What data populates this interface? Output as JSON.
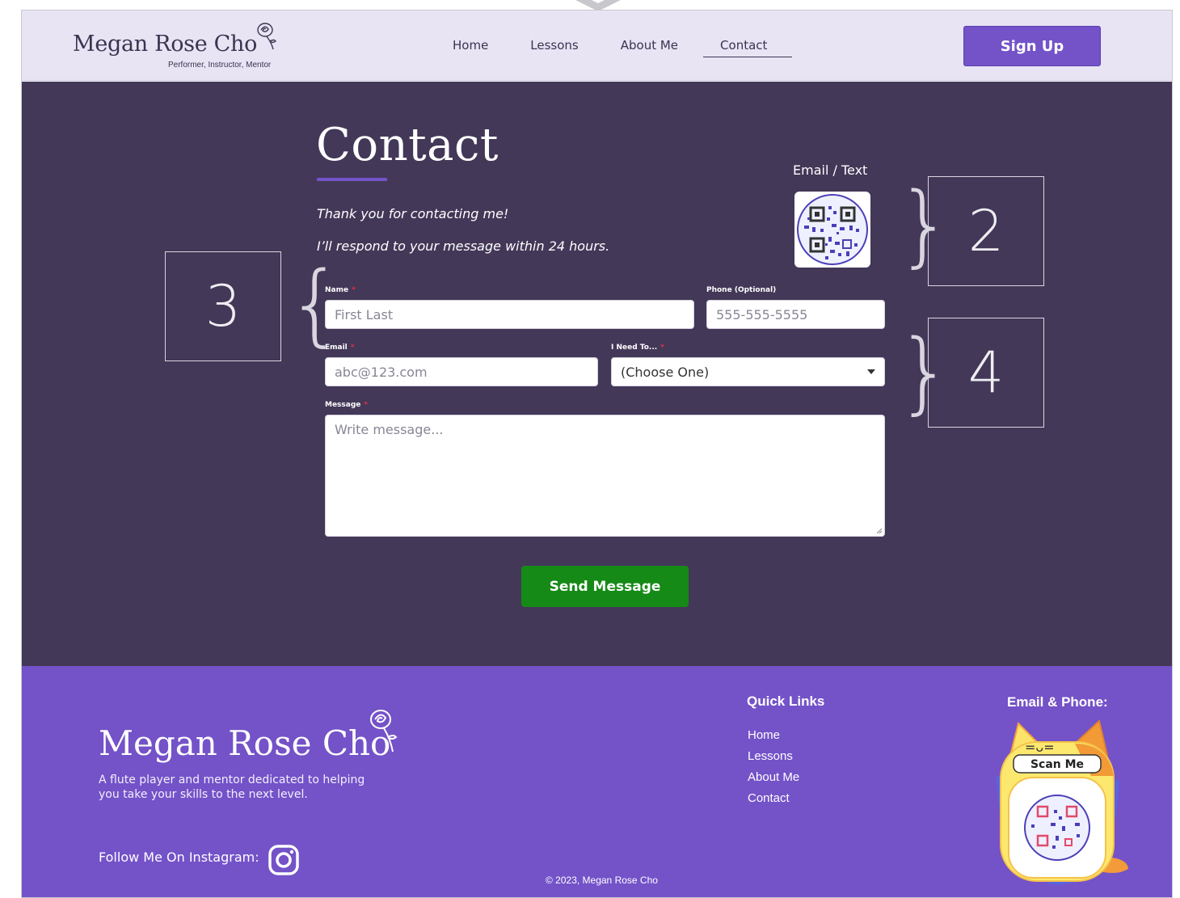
{
  "header": {
    "brand_name": "Megan Rose Cho",
    "brand_tagline": "Performer, Instructor, Mentor",
    "nav": [
      "Home",
      "Lessons",
      "About Me",
      "Contact"
    ],
    "active_nav": "Contact",
    "signup_label": "Sign Up"
  },
  "main": {
    "title": "Contact",
    "intro_line1": "Thank you for contacting me!",
    "intro_line2": "I’ll respond to your message within 24 hours.",
    "qr_label": "Email / Text",
    "form": {
      "name_label": "Name",
      "name_placeholder": "First Last",
      "phone_label": "Phone (Optional)",
      "phone_placeholder": "555-555-5555",
      "email_label": "Email",
      "email_placeholder": "abc@123.com",
      "need_label": "I Need To...",
      "need_value": "(Choose One)",
      "message_label": "Message",
      "message_placeholder": "Write message...",
      "required_mark": "*",
      "send_label": "Send Message"
    }
  },
  "annotations": {
    "box2": "2",
    "box3": "3",
    "box4": "4",
    "brace_left": "{",
    "brace_right": "}"
  },
  "footer": {
    "brand_name": "Megan Rose Cho",
    "description": "A flute player and mentor dedicated to helping you take your skills to the next level.",
    "follow_label": "Follow Me On Instagram:",
    "copyright": "© 2023, Megan Rose Cho",
    "quick_links_title": "Quick Links",
    "quick_links": [
      "Home",
      "Lessons",
      "About Me",
      "Contact"
    ],
    "email_phone_title": "Email & Phone:",
    "scan_label": "Scan Me"
  },
  "colors": {
    "header_bg": "#e8e4f4",
    "main_bg": "#433858",
    "accent": "#7452c8",
    "send_button": "#158a16",
    "required": "#e0304a"
  }
}
